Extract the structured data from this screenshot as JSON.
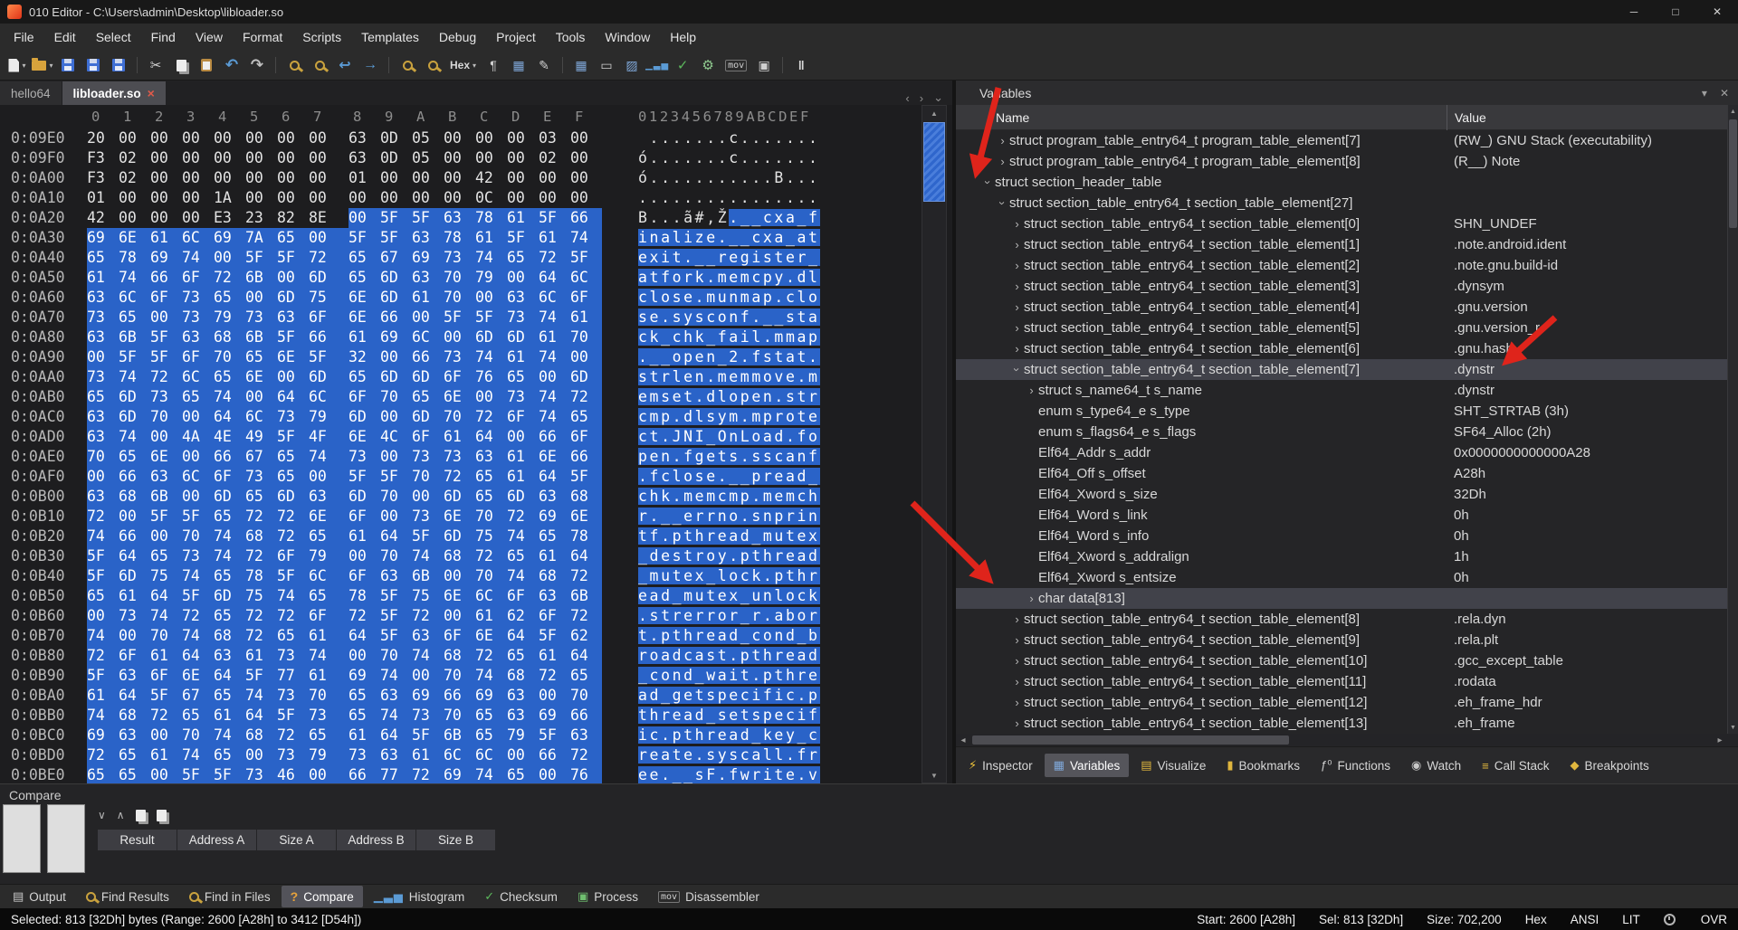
{
  "window": {
    "title": "010 Editor - C:\\Users\\admin\\Desktop\\libloader.so",
    "controls": {
      "minimize": "─",
      "maximize": "□",
      "close": "✕"
    }
  },
  "menubar": {
    "items": [
      "File",
      "Edit",
      "Select",
      "Find",
      "View",
      "Format",
      "Scripts",
      "Templates",
      "Debug",
      "Project",
      "Tools",
      "Window",
      "Help"
    ]
  },
  "toolbar": {
    "items": [
      {
        "name": "new-file",
        "kind": "page",
        "caret": true
      },
      {
        "name": "open-file",
        "kind": "folder",
        "caret": true
      },
      {
        "name": "save",
        "kind": "floppy"
      },
      {
        "name": "save-as",
        "kind": "floppy"
      },
      {
        "name": "save-all",
        "kind": "floppy"
      },
      {
        "kind": "sep"
      },
      {
        "name": "cut",
        "kind": "cut",
        "text": "✂"
      },
      {
        "name": "copy",
        "kind": "copy"
      },
      {
        "name": "paste",
        "kind": "paste"
      },
      {
        "name": "undo",
        "kind": "undo",
        "text": "↶"
      },
      {
        "name": "redo",
        "kind": "redo",
        "text": "↷"
      },
      {
        "kind": "sep"
      },
      {
        "name": "find",
        "kind": "mag"
      },
      {
        "name": "find-next",
        "kind": "mag"
      },
      {
        "name": "jump-back",
        "kind": "back",
        "text": "↩"
      },
      {
        "name": "jump-forward",
        "kind": "fwd",
        "text": "→"
      },
      {
        "kind": "sep"
      },
      {
        "name": "find-in-files",
        "kind": "mag"
      },
      {
        "name": "replace-in-files",
        "kind": "mag"
      },
      {
        "name": "hex-view",
        "kind": "hexlbl",
        "text": "Hex",
        "caret": true
      },
      {
        "name": "show-formatting",
        "kind": "pilcrow",
        "text": "¶"
      },
      {
        "name": "grid-view",
        "kind": "grid",
        "text": "▦"
      },
      {
        "name": "edit-mode",
        "kind": "pencil",
        "text": "✎"
      },
      {
        "kind": "sep"
      },
      {
        "name": "goto-template",
        "kind": "grid",
        "text": "▦"
      },
      {
        "name": "select-block",
        "kind": "rect",
        "text": "▭"
      },
      {
        "name": "color-map",
        "kind": "hatch",
        "text": "▨"
      },
      {
        "name": "histogram-tool",
        "kind": "bars",
        "text": "▁▃▅"
      },
      {
        "name": "checksum-tool",
        "kind": "check",
        "text": "✓"
      },
      {
        "name": "process-tool",
        "kind": "gear",
        "text": "⚙"
      },
      {
        "name": "disassembler-tool",
        "kind": "movlbl",
        "text": "mov"
      },
      {
        "name": "capture",
        "kind": "film",
        "text": "▣"
      },
      {
        "kind": "sep"
      },
      {
        "name": "pause",
        "kind": "pause",
        "text": "‖"
      }
    ]
  },
  "tabs": {
    "items": [
      {
        "label": "hello64",
        "active": false
      },
      {
        "label": "libloader.so",
        "active": true
      }
    ],
    "close_glyph": "×",
    "nav": {
      "prev": "‹",
      "next": "›",
      "list": "⌄"
    }
  },
  "scrollbars": {
    "up": "▲",
    "down": "▼",
    "left": "◂",
    "right": "▸"
  },
  "hex": {
    "byte_header": [
      "0",
      "1",
      "2",
      "3",
      "4",
      "5",
      "6",
      "7",
      "8",
      "9",
      "A",
      "B",
      "C",
      "D",
      "E",
      "F"
    ],
    "ascii_header": "0123456789ABCDEF",
    "selection_start_hex": "A28",
    "selection_end_hex": "D54",
    "rows": [
      {
        "addr": "0:09E0",
        "bytes": "20 00 00 00 00 00 00 00 63 0D 05 00 00 00 03 00",
        "ascii": " .......c......."
      },
      {
        "addr": "0:09F0",
        "bytes": "F3 02 00 00 00 00 00 00 63 0D 05 00 00 00 02 00",
        "ascii": "ó.......c......."
      },
      {
        "addr": "0:0A00",
        "bytes": "F3 02 00 00 00 00 00 00 01 00 00 00 42 00 00 00",
        "ascii": "ó...........B..."
      },
      {
        "addr": "0:0A10",
        "bytes": "01 00 00 00 1A 00 00 00 00 00 00 00 0C 00 00 00",
        "ascii": "................"
      },
      {
        "addr": "0:0A20",
        "bytes": "42 00 00 00 E3 23 82 8E 00 5F 5F 63 78 61 5F 66",
        "ascii": "B...ã#‚Ž.__cxa_f"
      },
      {
        "addr": "0:0A30",
        "bytes": "69 6E 61 6C 69 7A 65 00 5F 5F 63 78 61 5F 61 74",
        "ascii": "inalize.__cxa_at"
      },
      {
        "addr": "0:0A40",
        "bytes": "65 78 69 74 00 5F 5F 72 65 67 69 73 74 65 72 5F",
        "ascii": "exit.__register_"
      },
      {
        "addr": "0:0A50",
        "bytes": "61 74 66 6F 72 6B 00 6D 65 6D 63 70 79 00 64 6C",
        "ascii": "atfork.memcpy.dl"
      },
      {
        "addr": "0:0A60",
        "bytes": "63 6C 6F 73 65 00 6D 75 6E 6D 61 70 00 63 6C 6F",
        "ascii": "close.munmap.clo"
      },
      {
        "addr": "0:0A70",
        "bytes": "73 65 00 73 79 73 63 6F 6E 66 00 5F 5F 73 74 61",
        "ascii": "se.sysconf.__sta"
      },
      {
        "addr": "0:0A80",
        "bytes": "63 6B 5F 63 68 6B 5F 66 61 69 6C 00 6D 6D 61 70",
        "ascii": "ck_chk_fail.mmap"
      },
      {
        "addr": "0:0A90",
        "bytes": "00 5F 5F 6F 70 65 6E 5F 32 00 66 73 74 61 74 00",
        "ascii": ".__open_2.fstat."
      },
      {
        "addr": "0:0AA0",
        "bytes": "73 74 72 6C 65 6E 00 6D 65 6D 6D 6F 76 65 00 6D",
        "ascii": "strlen.memmove.m"
      },
      {
        "addr": "0:0AB0",
        "bytes": "65 6D 73 65 74 00 64 6C 6F 70 65 6E 00 73 74 72",
        "ascii": "emset.dlopen.str"
      },
      {
        "addr": "0:0AC0",
        "bytes": "63 6D 70 00 64 6C 73 79 6D 00 6D 70 72 6F 74 65",
        "ascii": "cmp.dlsym.mprote"
      },
      {
        "addr": "0:0AD0",
        "bytes": "63 74 00 4A 4E 49 5F 4F 6E 4C 6F 61 64 00 66 6F",
        "ascii": "ct.JNI_OnLoad.fo"
      },
      {
        "addr": "0:0AE0",
        "bytes": "70 65 6E 00 66 67 65 74 73 00 73 73 63 61 6E 66",
        "ascii": "pen.fgets.sscanf"
      },
      {
        "addr": "0:0AF0",
        "bytes": "00 66 63 6C 6F 73 65 00 5F 5F 70 72 65 61 64 5F",
        "ascii": ".fclose.__pread_"
      },
      {
        "addr": "0:0B00",
        "bytes": "63 68 6B 00 6D 65 6D 63 6D 70 00 6D 65 6D 63 68",
        "ascii": "chk.memcmp.memch"
      },
      {
        "addr": "0:0B10",
        "bytes": "72 00 5F 5F 65 72 72 6E 6F 00 73 6E 70 72 69 6E",
        "ascii": "r.__errno.snprin"
      },
      {
        "addr": "0:0B20",
        "bytes": "74 66 00 70 74 68 72 65 61 64 5F 6D 75 74 65 78",
        "ascii": "tf.pthread_mutex"
      },
      {
        "addr": "0:0B30",
        "bytes": "5F 64 65 73 74 72 6F 79 00 70 74 68 72 65 61 64",
        "ascii": "_destroy.pthread"
      },
      {
        "addr": "0:0B40",
        "bytes": "5F 6D 75 74 65 78 5F 6C 6F 63 6B 00 70 74 68 72",
        "ascii": "_mutex_lock.pthr"
      },
      {
        "addr": "0:0B50",
        "bytes": "65 61 64 5F 6D 75 74 65 78 5F 75 6E 6C 6F 63 6B",
        "ascii": "ead_mutex_unlock"
      },
      {
        "addr": "0:0B60",
        "bytes": "00 73 74 72 65 72 72 6F 72 5F 72 00 61 62 6F 72",
        "ascii": ".strerror_r.abor"
      },
      {
        "addr": "0:0B70",
        "bytes": "74 00 70 74 68 72 65 61 64 5F 63 6F 6E 64 5F 62",
        "ascii": "t.pthread_cond_b"
      },
      {
        "addr": "0:0B80",
        "bytes": "72 6F 61 64 63 61 73 74 00 70 74 68 72 65 61 64",
        "ascii": "roadcast.pthread"
      },
      {
        "addr": "0:0B90",
        "bytes": "5F 63 6F 6E 64 5F 77 61 69 74 00 70 74 68 72 65",
        "ascii": "_cond_wait.pthre"
      },
      {
        "addr": "0:0BA0",
        "bytes": "61 64 5F 67 65 74 73 70 65 63 69 66 69 63 00 70",
        "ascii": "ad_getspecific.p"
      },
      {
        "addr": "0:0BB0",
        "bytes": "74 68 72 65 61 64 5F 73 65 74 73 70 65 63 69 66",
        "ascii": "thread_setspecif"
      },
      {
        "addr": "0:0BC0",
        "bytes": "69 63 00 70 74 68 72 65 61 64 5F 6B 65 79 5F 63",
        "ascii": "ic.pthread_key_c"
      },
      {
        "addr": "0:0BD0",
        "bytes": "72 65 61 74 65 00 73 79 73 63 61 6C 6C 00 66 72",
        "ascii": "reate.syscall.fr"
      },
      {
        "addr": "0:0BE0",
        "bytes": "65 65 00 5F 5F 73 46 00 66 77 72 69 74 65 00 76",
        "ascii": "ee.__sF.fwrite.v"
      }
    ]
  },
  "variables": {
    "title": "Variables",
    "header_icons": {
      "menu": "▾",
      "close": "✕"
    },
    "columns": {
      "name": "Name",
      "value": "Value"
    },
    "rows": [
      {
        "level": 2,
        "arrow": "collapsed",
        "name": "struct program_table_entry64_t program_table_element[7]",
        "value": "(RW_) GNU Stack (executability)"
      },
      {
        "level": 2,
        "arrow": "collapsed",
        "name": "struct program_table_entry64_t program_table_element[8]",
        "value": "(R__) Note"
      },
      {
        "level": 1,
        "arrow": "expanded",
        "name": "struct section_header_table",
        "value": ""
      },
      {
        "level": 2,
        "arrow": "expanded",
        "name": "struct section_table_entry64_t section_table_element[27]",
        "value": ""
      },
      {
        "level": 3,
        "arrow": "collapsed",
        "name": "struct section_table_entry64_t section_table_element[0]",
        "value": "SHN_UNDEF"
      },
      {
        "level": 3,
        "arrow": "collapsed",
        "name": "struct section_table_entry64_t section_table_element[1]",
        "value": ".note.android.ident"
      },
      {
        "level": 3,
        "arrow": "collapsed",
        "name": "struct section_table_entry64_t section_table_element[2]",
        "value": ".note.gnu.build-id"
      },
      {
        "level": 3,
        "arrow": "collapsed",
        "name": "struct section_table_entry64_t section_table_element[3]",
        "value": ".dynsym"
      },
      {
        "level": 3,
        "arrow": "collapsed",
        "name": "struct section_table_entry64_t section_table_element[4]",
        "value": ".gnu.version"
      },
      {
        "level": 3,
        "arrow": "collapsed",
        "name": "struct section_table_entry64_t section_table_element[5]",
        "value": ".gnu.version_r"
      },
      {
        "level": 3,
        "arrow": "collapsed",
        "name": "struct section_table_entry64_t section_table_element[6]",
        "value": ".gnu.hash"
      },
      {
        "level": 3,
        "arrow": "expanded",
        "name": "struct section_table_entry64_t section_table_element[7]",
        "value": ".dynstr",
        "selected": true
      },
      {
        "level": 4,
        "arrow": "collapsed",
        "name": "struct s_name64_t s_name",
        "value": ".dynstr"
      },
      {
        "level": 4,
        "arrow": "none",
        "name": "enum s_type64_e s_type",
        "value": "SHT_STRTAB (3h)"
      },
      {
        "level": 4,
        "arrow": "none",
        "name": "enum s_flags64_e s_flags",
        "value": "SF64_Alloc (2h)"
      },
      {
        "level": 4,
        "arrow": "none",
        "name": "Elf64_Addr s_addr",
        "value": "0x0000000000000A28"
      },
      {
        "level": 4,
        "arrow": "none",
        "name": "Elf64_Off s_offset",
        "value": "A28h"
      },
      {
        "level": 4,
        "arrow": "none",
        "name": "Elf64_Xword s_size",
        "value": "32Dh"
      },
      {
        "level": 4,
        "arrow": "none",
        "name": "Elf64_Word s_link",
        "value": "0h"
      },
      {
        "level": 4,
        "arrow": "none",
        "name": "Elf64_Word s_info",
        "value": "0h"
      },
      {
        "level": 4,
        "arrow": "none",
        "name": "Elf64_Xword s_addralign",
        "value": "1h"
      },
      {
        "level": 4,
        "arrow": "none",
        "name": "Elf64_Xword s_entsize",
        "value": "0h"
      },
      {
        "level": 4,
        "arrow": "collapsed",
        "name": "char data[813]",
        "value": "",
        "selected": true
      },
      {
        "level": 3,
        "arrow": "collapsed",
        "name": "struct section_table_entry64_t section_table_element[8]",
        "value": ".rela.dyn"
      },
      {
        "level": 3,
        "arrow": "collapsed",
        "name": "struct section_table_entry64_t section_table_element[9]",
        "value": ".rela.plt"
      },
      {
        "level": 3,
        "arrow": "collapsed",
        "name": "struct section_table_entry64_t section_table_element[10]",
        "value": ".gcc_except_table"
      },
      {
        "level": 3,
        "arrow": "collapsed",
        "name": "struct section_table_entry64_t section_table_element[11]",
        "value": ".rodata"
      },
      {
        "level": 3,
        "arrow": "collapsed",
        "name": "struct section_table_entry64_t section_table_element[12]",
        "value": ".eh_frame_hdr"
      },
      {
        "level": 3,
        "arrow": "collapsed",
        "name": "struct section_table_entry64_t section_table_element[13]",
        "value": ".eh_frame"
      }
    ]
  },
  "panel_tabs": {
    "items": [
      {
        "name": "inspector",
        "label": "Inspector",
        "icon": "⚡",
        "color": "#f0c53a"
      },
      {
        "name": "variables",
        "label": "Variables",
        "icon": "▦",
        "color": "#7fa7d8",
        "active": true
      },
      {
        "name": "visualize",
        "label": "Visualize",
        "icon": "▤",
        "color": "#e0b63e"
      },
      {
        "name": "bookmarks",
        "label": "Bookmarks",
        "icon": "▮",
        "color": "#e0b63e"
      },
      {
        "name": "functions",
        "label": "Functions",
        "icon": "ƒ⁰",
        "color": "#cfcfcf"
      },
      {
        "name": "watch",
        "label": "Watch",
        "icon": "◉",
        "color": "#c8c8c8"
      },
      {
        "name": "call-stack",
        "label": "Call Stack",
        "icon": "≡",
        "color": "#e0b63e"
      },
      {
        "name": "breakpoints",
        "label": "Breakpoints",
        "icon": "◆",
        "color": "#e0b63e"
      }
    ]
  },
  "compare": {
    "title": "Compare",
    "toolbar_icons": [
      {
        "name": "compare-collapse-icon",
        "glyph": "∨"
      },
      {
        "name": "compare-expand-icon",
        "glyph": "∧"
      },
      {
        "name": "compare-file-a-icon",
        "glyph": ""
      },
      {
        "name": "compare-file-b-icon",
        "glyph": ""
      }
    ],
    "columns": [
      "Result",
      "Address A",
      "Size A",
      "Address B",
      "Size B"
    ]
  },
  "bottom_tabs": {
    "items": [
      {
        "name": "output",
        "label": "Output",
        "kind": "win",
        "icon": "▤"
      },
      {
        "name": "find-results",
        "label": "Find Results",
        "kind": "mag"
      },
      {
        "name": "find-in-files",
        "label": "Find in Files",
        "kind": "mag"
      },
      {
        "name": "compare",
        "label": "Compare",
        "kind": "q",
        "icon": "?",
        "active": true
      },
      {
        "name": "histogram",
        "label": "Histogram",
        "kind": "bars",
        "icon": "▁▃▅"
      },
      {
        "name": "checksum",
        "label": "Checksum",
        "kind": "check",
        "icon": "✓"
      },
      {
        "name": "process",
        "label": "Process",
        "kind": "proc",
        "icon": "▣"
      },
      {
        "name": "disassembler",
        "label": "Disassembler",
        "kind": "mov",
        "icon": "mov"
      }
    ]
  },
  "status": {
    "left": "Selected: 813 [32Dh] bytes (Range: 2600 [A28h] to 3412 [D54h])",
    "right_segments": [
      "Start: 2600 [A28h]",
      "Sel: 813 [32Dh]",
      "Size: 702,200",
      "Hex",
      "ANSI",
      "LIT",
      "OVR"
    ]
  },
  "colors": {
    "selection_blue": "#2a63c8",
    "annotation_arrow_red": "#df241b",
    "active_tab_gray": "#4d4d52"
  }
}
